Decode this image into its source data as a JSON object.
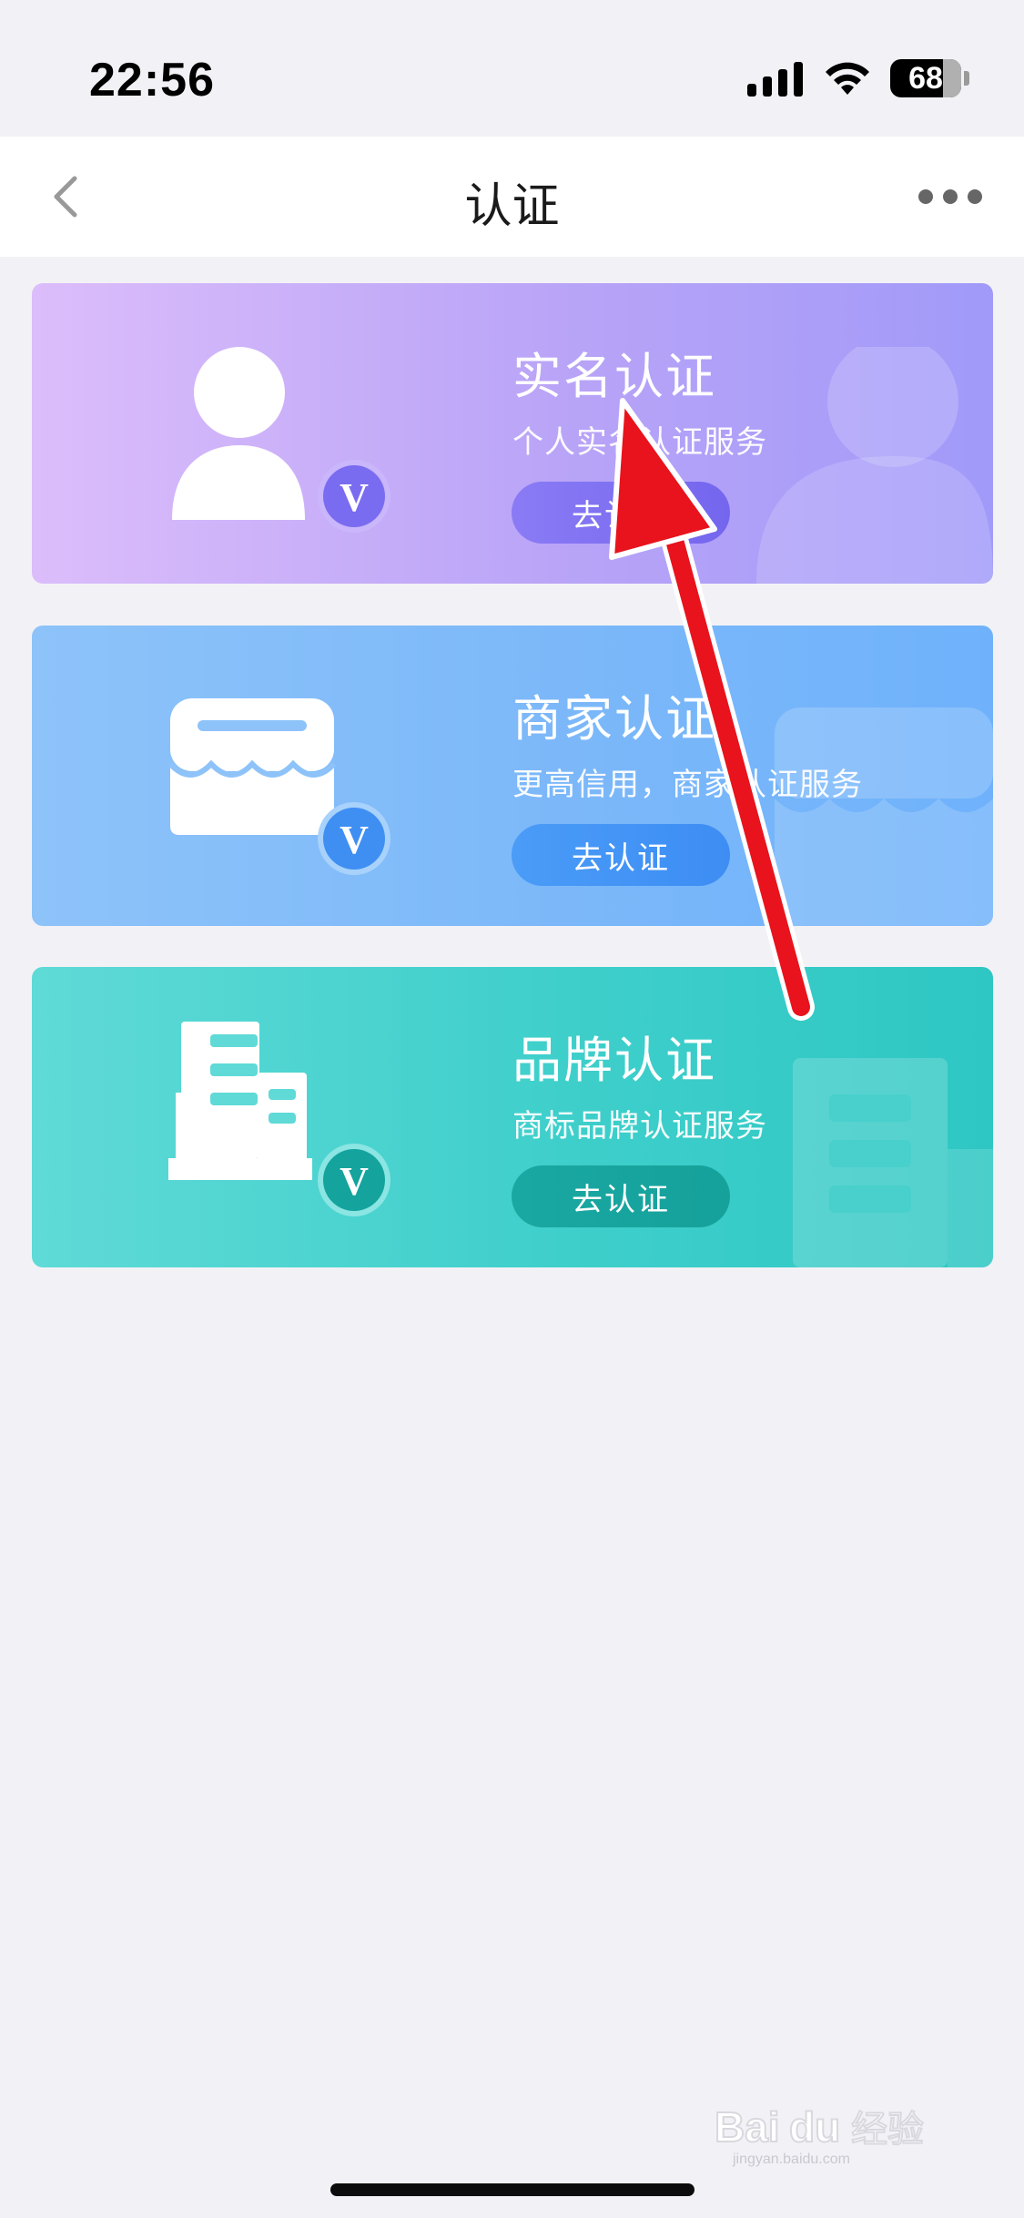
{
  "status_bar": {
    "time": "22:56",
    "battery": "68"
  },
  "nav": {
    "title": "认证",
    "back_icon": "chevron-left-icon",
    "more_icon": "more-horizontal-icon"
  },
  "cards": [
    {
      "title": "实名认证",
      "subtitle": "个人实名认证服务",
      "button": "去认证",
      "icon": "person-verified-icon"
    },
    {
      "title": "商家认证",
      "subtitle": "更高信用，商家认证服务",
      "button": "去认证",
      "icon": "store-verified-icon"
    },
    {
      "title": "品牌认证",
      "subtitle": "商标品牌认证服务",
      "button": "去认证",
      "icon": "building-verified-icon"
    }
  ],
  "colors": {
    "card_1": "#b9a4f7",
    "card_2": "#7cb8f9",
    "card_3": "#3fcfcb",
    "annotation_arrow": "#e8131c"
  },
  "watermark": {
    "text": "Bai du 经验",
    "subtext": "jingyan.baidu.com"
  }
}
